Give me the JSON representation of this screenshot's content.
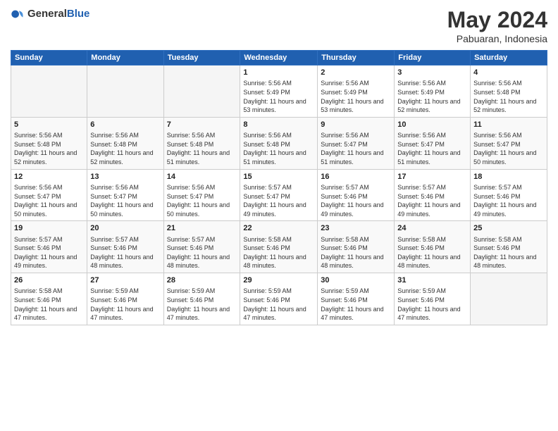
{
  "logo": {
    "general": "General",
    "blue": "Blue"
  },
  "title": {
    "month": "May 2024",
    "location": "Pabuaran, Indonesia"
  },
  "weekdays": [
    "Sunday",
    "Monday",
    "Tuesday",
    "Wednesday",
    "Thursday",
    "Friday",
    "Saturday"
  ],
  "weeks": [
    [
      {
        "day": "",
        "info": ""
      },
      {
        "day": "",
        "info": ""
      },
      {
        "day": "",
        "info": ""
      },
      {
        "day": "1",
        "info": "Sunrise: 5:56 AM\nSunset: 5:49 PM\nDaylight: 11 hours and 53 minutes."
      },
      {
        "day": "2",
        "info": "Sunrise: 5:56 AM\nSunset: 5:49 PM\nDaylight: 11 hours and 53 minutes."
      },
      {
        "day": "3",
        "info": "Sunrise: 5:56 AM\nSunset: 5:49 PM\nDaylight: 11 hours and 52 minutes."
      },
      {
        "day": "4",
        "info": "Sunrise: 5:56 AM\nSunset: 5:48 PM\nDaylight: 11 hours and 52 minutes."
      }
    ],
    [
      {
        "day": "5",
        "info": "Sunrise: 5:56 AM\nSunset: 5:48 PM\nDaylight: 11 hours and 52 minutes."
      },
      {
        "day": "6",
        "info": "Sunrise: 5:56 AM\nSunset: 5:48 PM\nDaylight: 11 hours and 52 minutes."
      },
      {
        "day": "7",
        "info": "Sunrise: 5:56 AM\nSunset: 5:48 PM\nDaylight: 11 hours and 51 minutes."
      },
      {
        "day": "8",
        "info": "Sunrise: 5:56 AM\nSunset: 5:48 PM\nDaylight: 11 hours and 51 minutes."
      },
      {
        "day": "9",
        "info": "Sunrise: 5:56 AM\nSunset: 5:47 PM\nDaylight: 11 hours and 51 minutes."
      },
      {
        "day": "10",
        "info": "Sunrise: 5:56 AM\nSunset: 5:47 PM\nDaylight: 11 hours and 51 minutes."
      },
      {
        "day": "11",
        "info": "Sunrise: 5:56 AM\nSunset: 5:47 PM\nDaylight: 11 hours and 50 minutes."
      }
    ],
    [
      {
        "day": "12",
        "info": "Sunrise: 5:56 AM\nSunset: 5:47 PM\nDaylight: 11 hours and 50 minutes."
      },
      {
        "day": "13",
        "info": "Sunrise: 5:56 AM\nSunset: 5:47 PM\nDaylight: 11 hours and 50 minutes."
      },
      {
        "day": "14",
        "info": "Sunrise: 5:56 AM\nSunset: 5:47 PM\nDaylight: 11 hours and 50 minutes."
      },
      {
        "day": "15",
        "info": "Sunrise: 5:57 AM\nSunset: 5:47 PM\nDaylight: 11 hours and 49 minutes."
      },
      {
        "day": "16",
        "info": "Sunrise: 5:57 AM\nSunset: 5:46 PM\nDaylight: 11 hours and 49 minutes."
      },
      {
        "day": "17",
        "info": "Sunrise: 5:57 AM\nSunset: 5:46 PM\nDaylight: 11 hours and 49 minutes."
      },
      {
        "day": "18",
        "info": "Sunrise: 5:57 AM\nSunset: 5:46 PM\nDaylight: 11 hours and 49 minutes."
      }
    ],
    [
      {
        "day": "19",
        "info": "Sunrise: 5:57 AM\nSunset: 5:46 PM\nDaylight: 11 hours and 49 minutes."
      },
      {
        "day": "20",
        "info": "Sunrise: 5:57 AM\nSunset: 5:46 PM\nDaylight: 11 hours and 48 minutes."
      },
      {
        "day": "21",
        "info": "Sunrise: 5:57 AM\nSunset: 5:46 PM\nDaylight: 11 hours and 48 minutes."
      },
      {
        "day": "22",
        "info": "Sunrise: 5:58 AM\nSunset: 5:46 PM\nDaylight: 11 hours and 48 minutes."
      },
      {
        "day": "23",
        "info": "Sunrise: 5:58 AM\nSunset: 5:46 PM\nDaylight: 11 hours and 48 minutes."
      },
      {
        "day": "24",
        "info": "Sunrise: 5:58 AM\nSunset: 5:46 PM\nDaylight: 11 hours and 48 minutes."
      },
      {
        "day": "25",
        "info": "Sunrise: 5:58 AM\nSunset: 5:46 PM\nDaylight: 11 hours and 48 minutes."
      }
    ],
    [
      {
        "day": "26",
        "info": "Sunrise: 5:58 AM\nSunset: 5:46 PM\nDaylight: 11 hours and 47 minutes."
      },
      {
        "day": "27",
        "info": "Sunrise: 5:59 AM\nSunset: 5:46 PM\nDaylight: 11 hours and 47 minutes."
      },
      {
        "day": "28",
        "info": "Sunrise: 5:59 AM\nSunset: 5:46 PM\nDaylight: 11 hours and 47 minutes."
      },
      {
        "day": "29",
        "info": "Sunrise: 5:59 AM\nSunset: 5:46 PM\nDaylight: 11 hours and 47 minutes."
      },
      {
        "day": "30",
        "info": "Sunrise: 5:59 AM\nSunset: 5:46 PM\nDaylight: 11 hours and 47 minutes."
      },
      {
        "day": "31",
        "info": "Sunrise: 5:59 AM\nSunset: 5:46 PM\nDaylight: 11 hours and 47 minutes."
      },
      {
        "day": "",
        "info": ""
      }
    ]
  ]
}
